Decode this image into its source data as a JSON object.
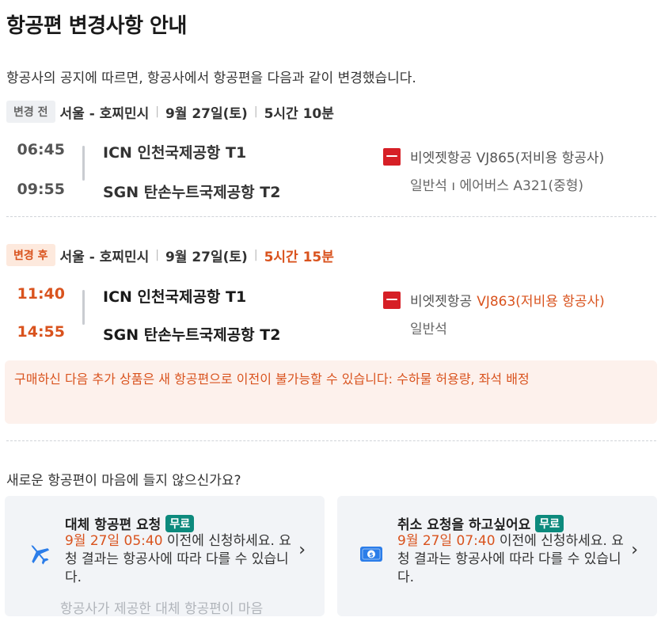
{
  "page_title": "항공편 변경사항 안내",
  "intro": "항공사의 공지에 따르면, 항공사에서 항공편을 다음과 같이 변경했습니다.",
  "before": {
    "tag": "변경 전",
    "route": "서울 - 호찌민시",
    "date": "9월 27일(토)",
    "duration": "5시간 10분",
    "dep_time": "06:45",
    "arr_time": "09:55",
    "dep_airport": "ICN 인천국제공항 T1",
    "arr_airport": "SGN 탄손누트국제공항 T2",
    "airline": "비엣젯항공 VJ865(저비용 항공사)",
    "cabin_info": "일반석 ı 에어버스 A321(중형)"
  },
  "after": {
    "tag": "변경 후",
    "route": "서울 - 호찌민시",
    "date": "9월 27일(토)",
    "duration": "5시간 15분",
    "dep_time": "11:40",
    "arr_time": "14:55",
    "dep_airport": "ICN 인천국제공항 T1",
    "arr_airport": "SGN 탄손누트국제공항 T2",
    "airline_name": "비엣젯항공",
    "flight_info": "VJ863(저비용 항공사)",
    "cabin_info": "일반석"
  },
  "warning": "구매하신 다음 추가 상품은 새 항공편으로 이전이 불가능할 수 있습니다: 수하물 허용량, 좌석 배정",
  "question": "새로운 항공편이 마음에 들지 않으신가요?",
  "cards": [
    {
      "title": "대체 항공편 요청",
      "badge": "무료",
      "deadline": "9월 27일 05:40",
      "desc_rest": " 이전에 신청하세요. 요청 결과는 항공사에 따라 다를 수 있습니다.",
      "footer": "항공사가 제공한 대체 항공편이 마음",
      "icon": "airplane-icon"
    },
    {
      "title": "취소 요청을 하고싶어요",
      "badge": "무료",
      "deadline": "9월 27일 07:40",
      "desc_rest": " 이전에 신청하세요. 요청 결과는 항공사에 따라 다를 수 있습니다.",
      "icon": "money-icon"
    }
  ],
  "colors": {
    "accent": "#d9531e",
    "badge": "#0d8a7d",
    "airline_logo": "#d61f26"
  }
}
